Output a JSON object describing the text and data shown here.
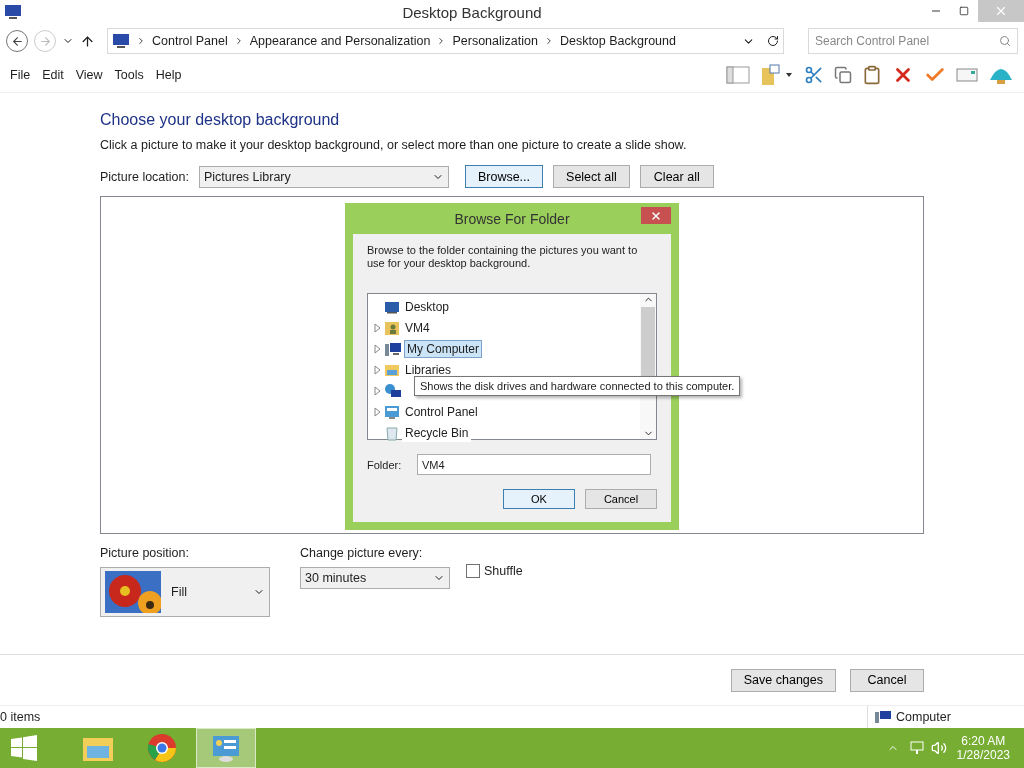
{
  "window": {
    "title": "Desktop Background"
  },
  "address": {
    "crumbs": [
      "Control Panel",
      "Appearance and Personalization",
      "Personalization",
      "Desktop Background"
    ],
    "search_placeholder": "Search Control Panel"
  },
  "menu": [
    "File",
    "Edit",
    "View",
    "Tools",
    "Help"
  ],
  "content": {
    "heading": "Choose your desktop background",
    "description": "Click a picture to make it your desktop background, or select more than one picture to create a slide show.",
    "location_label": "Picture location:",
    "location_value": "Pictures Library",
    "buttons": [
      {
        "label": "Browse...",
        "selected": true
      },
      {
        "label": "Select all",
        "selected": false
      },
      {
        "label": "Clear all",
        "selected": false
      }
    ]
  },
  "dialog": {
    "title": "Browse For Folder",
    "instruction": "Browse to the folder containing the pictures you want to use for your desktop background.",
    "tree": [
      {
        "label": "Desktop",
        "kind": "desktop",
        "expandable": false,
        "selected": false
      },
      {
        "label": "VM4",
        "kind": "user-folder",
        "expandable": true,
        "selected": false
      },
      {
        "label": "My Computer",
        "kind": "computer",
        "expandable": true,
        "selected": true
      },
      {
        "label": "Libraries",
        "kind": "libraries",
        "expandable": true,
        "selected": false
      },
      {
        "kind": "network",
        "expandable": true,
        "selected": false
      },
      {
        "label": "Control Panel",
        "kind": "control-panel",
        "expandable": true,
        "selected": false
      },
      {
        "label": "Recycle Bin",
        "kind": "recycle-bin",
        "expandable": false,
        "selected": false
      }
    ],
    "tooltip": "Shows the disk drives and hardware connected to this computer.",
    "folder_label": "Folder:",
    "folder_value": "VM4",
    "buttons": [
      {
        "label": "OK",
        "selected": true
      },
      {
        "label": "Cancel",
        "selected": false
      }
    ]
  },
  "options": {
    "position_label": "Picture position:",
    "position_value": "Fill",
    "interval_label": "Change picture every:",
    "interval_value": "30 minutes",
    "shuffle": {
      "label": "Shuffle",
      "checked": false
    }
  },
  "footer_buttons": [
    "Save changes",
    "Cancel"
  ],
  "status_bar": {
    "items": "0 items",
    "zone": "Computer"
  },
  "taskbar": {
    "apps": [
      {
        "kind": "explorer",
        "selected": false
      },
      {
        "kind": "chrome",
        "selected": false
      },
      {
        "kind": "control-panel",
        "selected": true
      }
    ],
    "time": "6:20 AM",
    "date": "1/28/2023"
  }
}
